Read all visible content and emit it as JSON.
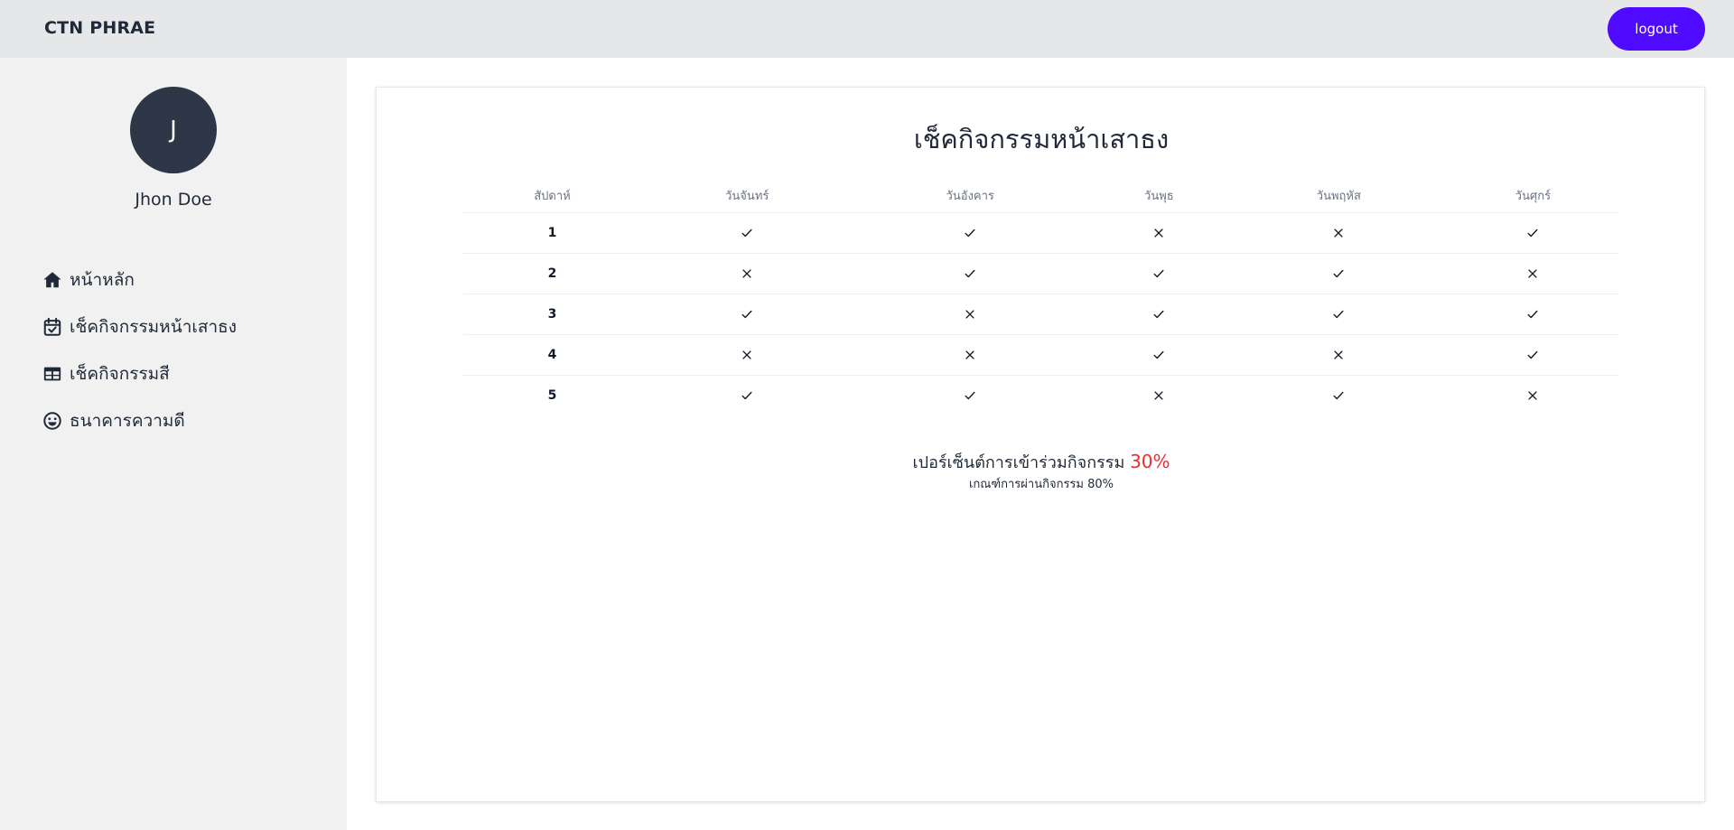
{
  "header": {
    "brand": "CTN PHRAE",
    "logout_label": "logout",
    "background_color": "#e5e7e8",
    "logout_color": "#4f0bff"
  },
  "sidebar": {
    "avatar_initial": "J",
    "user_name": "Jhon Doe",
    "items": [
      {
        "label": "หน้าหลัก",
        "icon": "home-icon"
      },
      {
        "label": "เช็คกิจกรรมหน้าเสาธง",
        "icon": "calendar-check-icon"
      },
      {
        "label": "เช็คกิจกรรมสี",
        "icon": "table-icon"
      },
      {
        "label": "ธนาคารความดี",
        "icon": "smile-icon"
      }
    ]
  },
  "main": {
    "title": "เช็คกิจกรรมหน้าเสาธง",
    "table": {
      "headers": [
        "สัปดาห์",
        "วันจันทร์",
        "วันอังคาร",
        "วันพุธ",
        "วันพฤหัส",
        "วันศุกร์"
      ],
      "rows": [
        {
          "week": "1",
          "marks": [
            "check",
            "check",
            "cross",
            "cross",
            "check"
          ]
        },
        {
          "week": "2",
          "marks": [
            "cross",
            "check",
            "check",
            "check",
            "cross"
          ]
        },
        {
          "week": "3",
          "marks": [
            "check",
            "cross",
            "check",
            "check",
            "check"
          ]
        },
        {
          "week": "4",
          "marks": [
            "cross",
            "cross",
            "check",
            "cross",
            "check"
          ]
        },
        {
          "week": "5",
          "marks": [
            "check",
            "check",
            "cross",
            "check",
            "cross"
          ]
        }
      ]
    },
    "percent_label": "เปอร์เซ็นต์การเข้าร่วมกิจกรรม",
    "percent_value": "30%",
    "percent_color": "#ef2d2d",
    "criteria_text": "เกณฑ์การผ่านกิจกรรม 80%"
  }
}
